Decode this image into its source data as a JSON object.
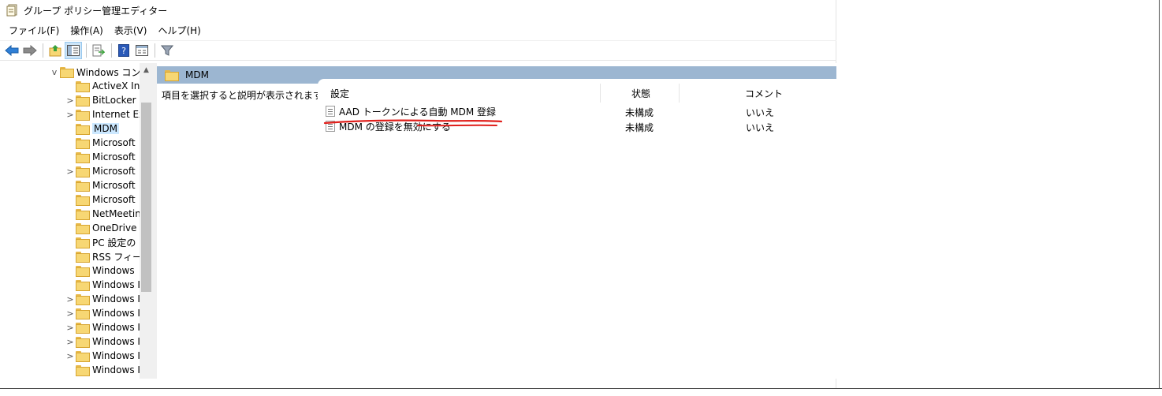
{
  "window": {
    "title": "グループ ポリシー管理エディター"
  },
  "menu": [
    "ファイル(F)",
    "操作(A)",
    "表示(V)",
    "ヘルプ(H)"
  ],
  "toolbar": {
    "icons": [
      "back-arrow-icon",
      "forward-arrow-icon",
      "up-folder-icon",
      "show-hide-tree-icon",
      "export-list-icon",
      "help-icon",
      "properties-icon",
      "filter-icon"
    ]
  },
  "tree": {
    "items": [
      {
        "label": "Windows コンポ",
        "expander": "v",
        "selected": false
      },
      {
        "label": "ActiveX In",
        "expander": "",
        "selected": false
      },
      {
        "label": "BitLocker",
        "expander": ">",
        "selected": false
      },
      {
        "label": "Internet Ex",
        "expander": ">",
        "selected": false
      },
      {
        "label": "MDM",
        "expander": "",
        "selected": true
      },
      {
        "label": "Microsoft",
        "expander": "",
        "selected": false
      },
      {
        "label": "Microsoft",
        "expander": "",
        "selected": false
      },
      {
        "label": "Microsoft",
        "expander": ">",
        "selected": false
      },
      {
        "label": "Microsoft",
        "expander": "",
        "selected": false
      },
      {
        "label": "Microsoft",
        "expander": "",
        "selected": false
      },
      {
        "label": "NetMeetin",
        "expander": "",
        "selected": false
      },
      {
        "label": "OneDrive",
        "expander": "",
        "selected": false
      },
      {
        "label": "PC 設定の",
        "expander": "",
        "selected": false
      },
      {
        "label": "RSS フィード",
        "expander": "",
        "selected": false
      },
      {
        "label": "Windows",
        "expander": "",
        "selected": false
      },
      {
        "label": "Windows I",
        "expander": "",
        "selected": false
      },
      {
        "label": "Windows I",
        "expander": ">",
        "selected": false
      },
      {
        "label": "Windows I",
        "expander": ">",
        "selected": false
      },
      {
        "label": "Windows I",
        "expander": ">",
        "selected": false
      },
      {
        "label": "Windows I",
        "expander": ">",
        "selected": false
      },
      {
        "label": "Windows I",
        "expander": ">",
        "selected": false
      },
      {
        "label": "Windows I",
        "expander": "",
        "selected": false
      }
    ]
  },
  "content": {
    "header": "MDM",
    "description": "項目を選択すると説明が表示されます。",
    "columns": {
      "setting": "設定",
      "state": "状態",
      "comment": "コメント"
    },
    "rows": [
      {
        "setting": "AAD トークンによる自動 MDM 登録",
        "state": "未構成",
        "comment": "いいえ"
      },
      {
        "setting": "MDM の登録を無効にする",
        "state": "未構成",
        "comment": "いいえ"
      }
    ]
  },
  "colors": {
    "header_bar": "#9cb6d1",
    "selection": "#cce8ff",
    "annotation": "#e0201c"
  }
}
